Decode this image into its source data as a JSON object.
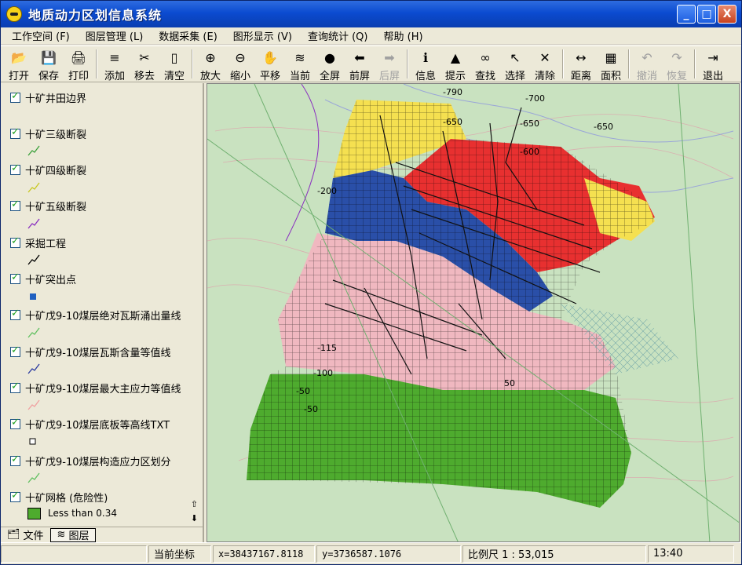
{
  "window": {
    "title": "地质动力区划信息系统",
    "controls": [
      "_",
      "□",
      "X"
    ]
  },
  "menu": [
    {
      "label": "工作空间 (F)"
    },
    {
      "label": "图层管理 (L)"
    },
    {
      "label": "数据采集 (E)"
    },
    {
      "label": "图形显示 (V)"
    },
    {
      "label": "查询统计 (Q)"
    },
    {
      "label": "帮助 (H)"
    }
  ],
  "toolbar": [
    {
      "label": "打开",
      "icon": "open-folder-icon",
      "glyph": "📂"
    },
    {
      "label": "保存",
      "icon": "save-icon",
      "glyph": "💾"
    },
    {
      "label": "打印",
      "icon": "print-icon",
      "glyph": "🖨"
    },
    {
      "label": "添加",
      "icon": "add-layer-icon",
      "glyph": "≡"
    },
    {
      "label": "移去",
      "icon": "remove-layer-icon",
      "glyph": "✂"
    },
    {
      "label": "清空",
      "icon": "clear-icon",
      "glyph": "▯"
    },
    {
      "label": "放大",
      "icon": "zoom-in-icon",
      "glyph": "⊕"
    },
    {
      "label": "缩小",
      "icon": "zoom-out-icon",
      "glyph": "⊖"
    },
    {
      "label": "平移",
      "icon": "pan-hand-icon",
      "glyph": "✋"
    },
    {
      "label": "当前",
      "icon": "current-view-icon",
      "glyph": "≋"
    },
    {
      "label": "全屏",
      "icon": "globe-icon",
      "glyph": "●"
    },
    {
      "label": "前屏",
      "icon": "back-arrow-icon",
      "glyph": "⬅"
    },
    {
      "label": "后屏",
      "icon": "forward-arrow-icon",
      "glyph": "➡",
      "disabled": true
    },
    {
      "label": "信息",
      "icon": "info-icon",
      "glyph": "ℹ"
    },
    {
      "label": "提示",
      "icon": "warning-icon",
      "glyph": "▲"
    },
    {
      "label": "查找",
      "icon": "binoculars-icon",
      "glyph": "∞"
    },
    {
      "label": "选择",
      "icon": "select-cursor-icon",
      "glyph": "↖"
    },
    {
      "label": "清除",
      "icon": "clear-selection-icon",
      "glyph": "✕"
    },
    {
      "label": "距离",
      "icon": "measure-distance-icon",
      "glyph": "↔"
    },
    {
      "label": "面积",
      "icon": "measure-area-icon",
      "glyph": "▦"
    },
    {
      "label": "撤消",
      "icon": "undo-icon",
      "glyph": "↶",
      "disabled": true
    },
    {
      "label": "恢复",
      "icon": "redo-icon",
      "glyph": "↷",
      "disabled": true
    },
    {
      "label": "退出",
      "icon": "exit-door-icon",
      "glyph": "⇥"
    }
  ],
  "layers": [
    {
      "name": "十矿井田边界",
      "symbol": "none"
    },
    {
      "name": "十矿三级断裂",
      "symbol": "line",
      "color": "#3aa03a"
    },
    {
      "name": "十矿四级断裂",
      "symbol": "line",
      "color": "#c8c820"
    },
    {
      "name": "十矿五级断裂",
      "symbol": "line",
      "color": "#8a2fc0"
    },
    {
      "name": "采掘工程",
      "symbol": "line",
      "color": "#000000"
    },
    {
      "name": "十矿突出点",
      "symbol": "square",
      "color": "#2060c0"
    },
    {
      "name": "十矿戊9-10煤层绝对瓦斯涌出量线",
      "symbol": "line",
      "color": "#60c060"
    },
    {
      "name": "十矿戊9-10煤层瓦斯含量等值线",
      "symbol": "line",
      "color": "#2a3aa0"
    },
    {
      "name": "十矿戊9-10煤层最大主应力等值线",
      "symbol": "line",
      "color": "#f0a0a0"
    },
    {
      "name": "十矿戊9-10煤层底板等高线TXT",
      "symbol": "hollow-square",
      "color": "#000000"
    },
    {
      "name": "十矿戊9-10煤层构造应力区划分",
      "symbol": "line",
      "color": "#60c060"
    },
    {
      "name": "十矿网格 (危险性)",
      "symbol": "none"
    }
  ],
  "legend": {
    "label": "Less than 0.34",
    "color": "#4eab2e"
  },
  "panel_tabs": [
    {
      "label": "文件"
    },
    {
      "label": "图层"
    }
  ],
  "map": {
    "contour_labels": [
      "-790",
      "-700",
      "-650",
      "-650",
      "-650",
      "-600",
      "-200",
      "-100",
      "-50",
      "-50",
      "50",
      "-115"
    ],
    "colors": {
      "green": "#4eab2e",
      "pink": "#f0b8c0",
      "blue": "#2a4fa8",
      "red": "#e83030",
      "yellow": "#f5e050",
      "background": "#c9e2c0"
    }
  },
  "status": {
    "label": "当前坐标",
    "x": "x=38437167.8118",
    "y": "y=3736587.1076",
    "scale": "比例尺 1 : 53,015",
    "time": "13:40"
  }
}
